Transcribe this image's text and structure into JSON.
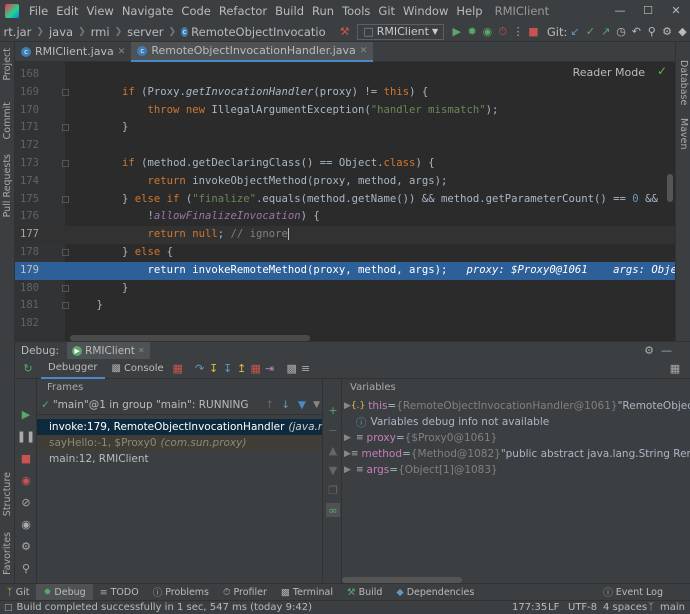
{
  "menubar": {
    "items": [
      "File",
      "Edit",
      "View",
      "Navigate",
      "Code",
      "Refactor",
      "Build",
      "Run",
      "Tools",
      "Git",
      "Window",
      "Help"
    ],
    "window_title": "RMIClient"
  },
  "navbar": {
    "crumbs": [
      "rt.jar",
      "java",
      "rmi",
      "server",
      "RemoteObjectInvocatio"
    ],
    "run_config": "RMIClient",
    "git_label": "Git:"
  },
  "editor_tabs": [
    {
      "label": "RMIClient.java",
      "active": false
    },
    {
      "label": "RemoteObjectInvocationHandler.java",
      "active": true
    }
  ],
  "editor": {
    "reader_mode": "Reader Mode",
    "line_numbers": [
      "168",
      "169",
      "170",
      "171",
      "172",
      "173",
      "174",
      "175",
      "176",
      "177",
      "178",
      "179",
      "180",
      "181",
      "182"
    ],
    "current_line": "177",
    "exec_line": "179"
  },
  "left_stripe": [
    "Project",
    "Commit",
    "Pull Requests",
    "Structure",
    "Favorites"
  ],
  "right_stripe": [
    "Database",
    "Maven"
  ],
  "debug": {
    "title": "Debug:",
    "session": "RMIClient",
    "tabs": [
      "Debugger",
      "Console"
    ],
    "frames_header": "Frames",
    "thread": "\"main\"@1 in group \"main\": RUNNING",
    "frames": [
      {
        "text": "invoke:179, RemoteObjectInvocationHandler",
        "pkg": "(java.rmi.server)",
        "kind": "selected"
      },
      {
        "text": "sayHello:-1, $Proxy0",
        "pkg": "(com.sun.proxy)",
        "kind": "library"
      },
      {
        "text": "main:12, RMIClient",
        "pkg": "",
        "kind": "normal"
      }
    ],
    "variables_header": "Variables",
    "variables": [
      {
        "name": "this",
        "eq": " = ",
        "type": "{RemoteObjectInvocationHandler@1061}",
        "value": " \"RemoteObjectInvoca",
        "expand": true,
        "icon": "this"
      },
      {
        "name": "",
        "eq": "",
        "type": "",
        "value": "Variables debug info not available",
        "expand": false,
        "icon": "info"
      },
      {
        "name": "proxy",
        "eq": " = ",
        "type": "{$Proxy0@1061}",
        "value": "",
        "expand": true,
        "icon": "param"
      },
      {
        "name": "method",
        "eq": " = ",
        "type": "{Method@1082}",
        "value": " \"public abstract java.lang.String RemoteOb",
        "expand": true,
        "icon": "param"
      },
      {
        "name": "args",
        "eq": " = ",
        "type": "{Object[1]@1083}",
        "value": "",
        "expand": true,
        "icon": "param"
      }
    ]
  },
  "bottom_tabs": [
    "Git",
    "Debug",
    "TODO",
    "Problems",
    "Profiler",
    "Terminal",
    "Build",
    "Dependencies"
  ],
  "event_log": "Event Log",
  "status": {
    "message": "Build completed successfully in 1 sec, 547 ms (today 9:42)",
    "position": "177:35",
    "line_sep": "LF",
    "encoding": "UTF-8",
    "indent": "4 spaces",
    "branch": "main"
  },
  "colors": {
    "accent": "#4a88c7",
    "exec_line": "#2d6099",
    "selected_frame": "#0d293e",
    "keyword": "#cc7832",
    "string": "#6a8759",
    "method": "#ffc66d"
  }
}
